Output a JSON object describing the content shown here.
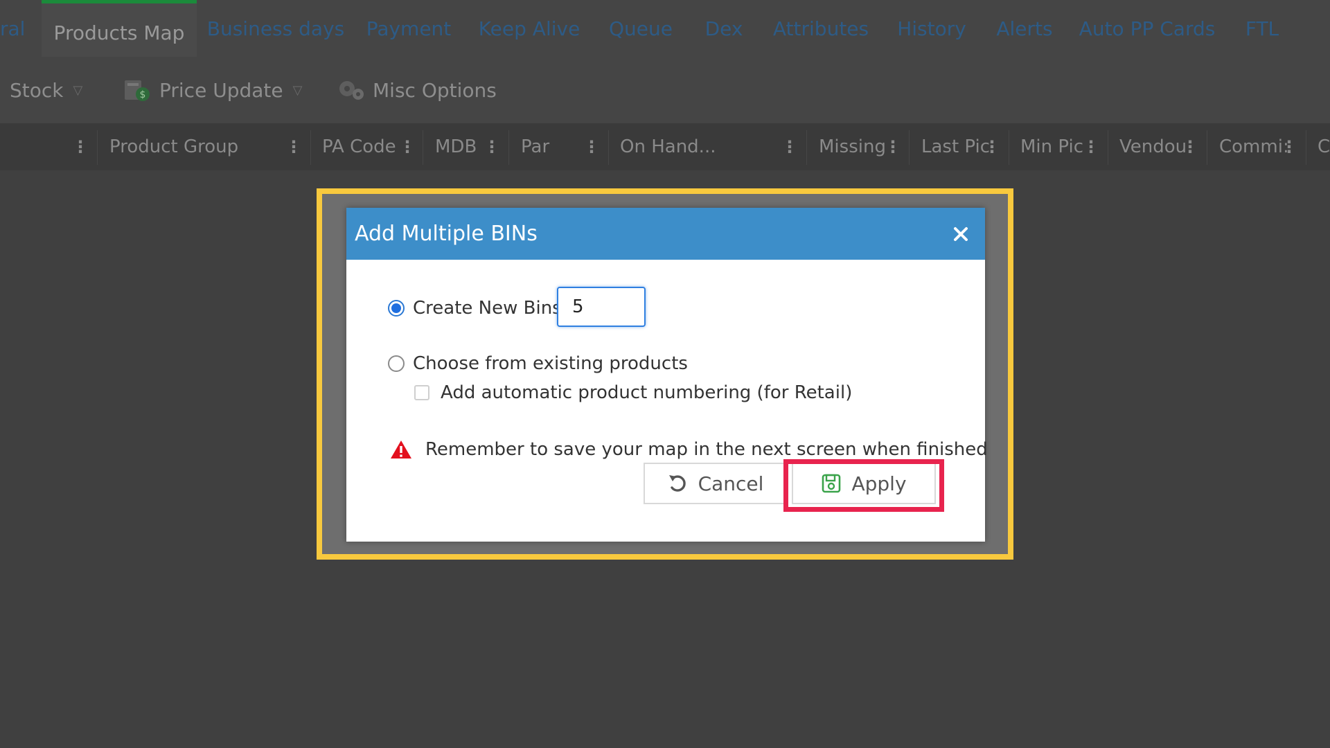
{
  "tabs": [
    {
      "label": "ral",
      "active": false
    },
    {
      "label": "Products Map",
      "active": true
    },
    {
      "label": "Business days",
      "active": false
    },
    {
      "label": "Payment",
      "active": false
    },
    {
      "label": "Keep Alive",
      "active": false
    },
    {
      "label": "Queue",
      "active": false
    },
    {
      "label": "Dex",
      "active": false
    },
    {
      "label": "Attributes",
      "active": false
    },
    {
      "label": "History",
      "active": false
    },
    {
      "label": "Alerts",
      "active": false
    },
    {
      "label": "Auto PP Cards",
      "active": false
    },
    {
      "label": "FTL",
      "active": false
    }
  ],
  "toolbar": {
    "stock_label": "Stock",
    "price_update_label": "Price Update",
    "misc_options_label": "Misc Options"
  },
  "grid": {
    "columns": [
      "Product Group",
      "PA Code",
      "MDB (",
      "Par",
      "On Hand...",
      "Missing",
      "Last Pic",
      "Min Pic",
      "Vendou",
      "Commi:",
      "C"
    ]
  },
  "dialog": {
    "title": "Add Multiple BINs",
    "create_new_label": "Create New Bins",
    "create_new_value": "5",
    "choose_existing_label": "Choose from existing products",
    "auto_numbering_label": "Add automatic product numbering (for Retail)",
    "warning_text": "Remember to save your map in the next screen when finished",
    "cancel_label": "Cancel",
    "apply_label": "Apply"
  },
  "colors": {
    "accent_blue": "#3d8ec9",
    "highlight_yellow": "#f8c93e",
    "highlight_red": "#e8244e",
    "warning_red": "#e3101e",
    "active_tab_green": "#1b8a3b"
  }
}
